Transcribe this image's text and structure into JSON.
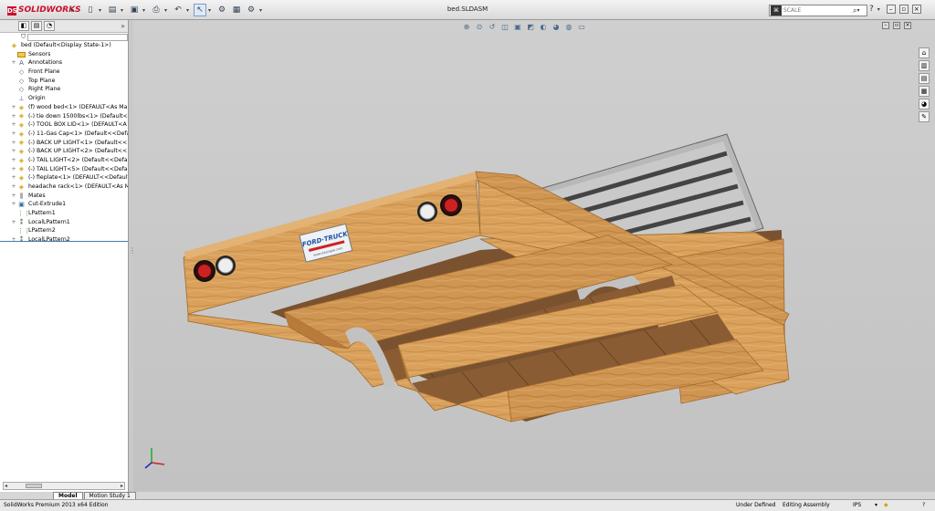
{
  "app": {
    "logo": "SOLIDWORKS",
    "doc_title": "bed.SLDASM"
  },
  "quick_access": {
    "icons": [
      "new-icon",
      "open-icon",
      "save-icon",
      "print-icon",
      "undo-icon",
      "select-icon",
      "rebuild-icon",
      "options-icon"
    ]
  },
  "search": {
    "scope_label": "⌘",
    "placeholder": "SCALE"
  },
  "feature_tree": {
    "items": [
      {
        "exp": "",
        "icon": "assembly",
        "label": "bed  (Default<Display State-1>)",
        "indent": 0
      },
      {
        "exp": "",
        "icon": "folder",
        "label": "Sensors",
        "indent": 1
      },
      {
        "exp": "+",
        "icon": "annot",
        "label": "Annotations",
        "indent": 1
      },
      {
        "exp": "",
        "icon": "plane",
        "label": "Front Plane",
        "indent": 1
      },
      {
        "exp": "",
        "icon": "plane",
        "label": "Top Plane",
        "indent": 1
      },
      {
        "exp": "",
        "icon": "plane",
        "label": "Right Plane",
        "indent": 1
      },
      {
        "exp": "",
        "icon": "origin",
        "label": "Origin",
        "indent": 1
      },
      {
        "exp": "+",
        "icon": "part",
        "label": "(f) wood bed<1> (DEFAULT<As Ma",
        "indent": 1
      },
      {
        "exp": "+",
        "icon": "part",
        "label": "(-) tie down 1500lbs<1> (Default<D",
        "indent": 1
      },
      {
        "exp": "+",
        "icon": "part",
        "label": "(-) TOOL BOX LID<1> (DEFAULT<A",
        "indent": 1
      },
      {
        "exp": "+",
        "icon": "part",
        "label": "(-) 11-Gas Cap<1> (Default<<Defa",
        "indent": 1
      },
      {
        "exp": "+",
        "icon": "part",
        "label": "(-) BACK UP LIGHT<1> (Default<<",
        "indent": 1
      },
      {
        "exp": "+",
        "icon": "part",
        "label": "(-) BACK UP LIGHT<2> (Default<<",
        "indent": 1
      },
      {
        "exp": "+",
        "icon": "part",
        "label": "(-) TAIL LIGHT<2> (Default<<Defa",
        "indent": 1
      },
      {
        "exp": "+",
        "icon": "part",
        "label": "(-) TAIL LIGHT<5> (Default<<Defa",
        "indent": 1
      },
      {
        "exp": "+",
        "icon": "part",
        "label": "(-) fieplate<1> (DEFAULT<<Default",
        "indent": 1
      },
      {
        "exp": "+",
        "icon": "part",
        "label": "headache rack<1> (DEFAULT<As M",
        "indent": 1
      },
      {
        "exp": "+",
        "icon": "mates",
        "label": "Mates",
        "indent": 1
      },
      {
        "exp": "+",
        "icon": "feature",
        "label": "Cut-Extrude1",
        "indent": 1
      },
      {
        "exp": "",
        "icon": "lpattern",
        "label": "LPattern1",
        "indent": 1
      },
      {
        "exp": "+",
        "icon": "localpattern",
        "label": "LocalLPattern1",
        "indent": 1
      },
      {
        "exp": "",
        "icon": "lpattern",
        "label": "LPattern2",
        "indent": 1
      },
      {
        "exp": "+",
        "icon": "localpattern",
        "label": "LocalLPattern2",
        "indent": 1
      }
    ]
  },
  "tabs": {
    "model": "Model",
    "motion": "Motion Study 1"
  },
  "status": {
    "edition": "SolidWorks Premium 2013 x64 Edition",
    "defined": "Under Defined",
    "mode": "Editing Assembly",
    "units": "IPS",
    "units_arrow": "◆"
  },
  "model_label": {
    "line1": "FORD·TRUCK",
    "line2": "www.example.com"
  },
  "colors": {
    "wood": "#d9a15c",
    "wood_dark": "#b87b3c",
    "viewport": "#c9c9c9",
    "accent": "#4a78c2"
  }
}
